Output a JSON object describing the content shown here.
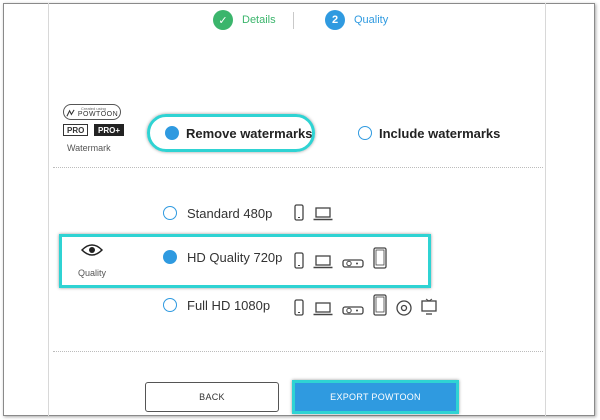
{
  "steps": [
    {
      "number": "✓",
      "label": "Details"
    },
    {
      "number": "2",
      "label": "Quality"
    }
  ],
  "watermark": {
    "badge_small_text": "Created using",
    "badge_logo": "POWTOON",
    "plans": [
      "PRO",
      "PRO+"
    ],
    "section_label": "Watermark",
    "options": [
      {
        "label": "Remove watermarks",
        "selected": true
      },
      {
        "label": "Include watermarks",
        "selected": false
      }
    ]
  },
  "quality": {
    "section_label": "Quality",
    "section_icon": "eye-icon",
    "options": [
      {
        "label": "Standard 480p",
        "selected": false,
        "devices": [
          "phone-icon",
          "laptop-icon"
        ]
      },
      {
        "label": "HD Quality 720p",
        "selected": true,
        "devices": [
          "phone-icon",
          "laptop-icon",
          "projector-icon",
          "tablet-icon"
        ]
      },
      {
        "label": "Full HD 1080p",
        "selected": false,
        "devices": [
          "phone-icon",
          "laptop-icon",
          "projector-icon",
          "tablet-icon",
          "disc-icon",
          "tv-icon"
        ]
      }
    ]
  },
  "buttons": {
    "back": "BACK",
    "export": "EXPORT POWTOON"
  },
  "colors": {
    "accent": "#2f9ae0",
    "success": "#3bb56c",
    "highlight": "#2fd3d3"
  }
}
